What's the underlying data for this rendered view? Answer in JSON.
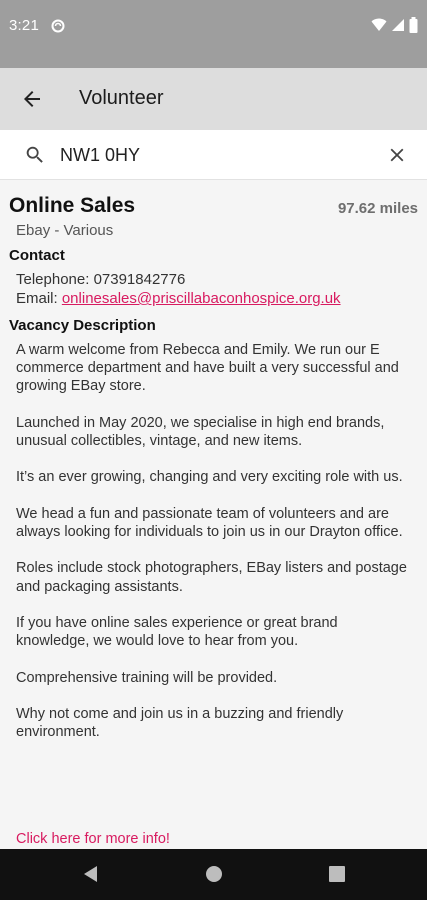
{
  "status_bar": {
    "time": "3:21",
    "icons": [
      "sync-icon",
      "wifi-icon",
      "signal-icon",
      "battery-icon"
    ]
  },
  "app_bar": {
    "title": "Volunteer",
    "back_icon": "arrow-back-icon"
  },
  "search": {
    "value": "NW1 0HY",
    "icon": "search-icon",
    "clear_icon": "close-icon"
  },
  "vacancy": {
    "title": "Online Sales",
    "distance": "97.62 miles",
    "location": "Ebay - Various",
    "contact_heading": "Contact",
    "telephone": "Telephone: 07391842776",
    "email_prefix": "Email: ",
    "email": "onlinesales@priscillabaconhospice.org.uk",
    "description_heading": "Vacancy Description",
    "description": [
      "A warm welcome from Rebecca and Emily. We run our E commerce department and have built a very successful and growing EBay store.",
      "Launched in May 2020, we specialise in high end brands, unusual collectibles, vintage, and new items.",
      "It’s an ever growing, changing and very exciting role with us.",
      "We head a fun and passionate team of volunteers and are always looking for individuals to join us in our Drayton office.",
      "Roles include stock photographers, EBay listers and postage and packaging assistants.",
      "If you have online sales experience or great brand knowledge, we would love to hear from you.",
      "Comprehensive training will be provided.",
      "Why not come and join us in a buzzing and friendly environment."
    ],
    "more_info": "Click here for more info!"
  },
  "colors": {
    "status_bar": "#9e9e9e",
    "app_bar": "#dddddd",
    "accent_link": "#d81b60",
    "nav_bar": "#111111"
  }
}
